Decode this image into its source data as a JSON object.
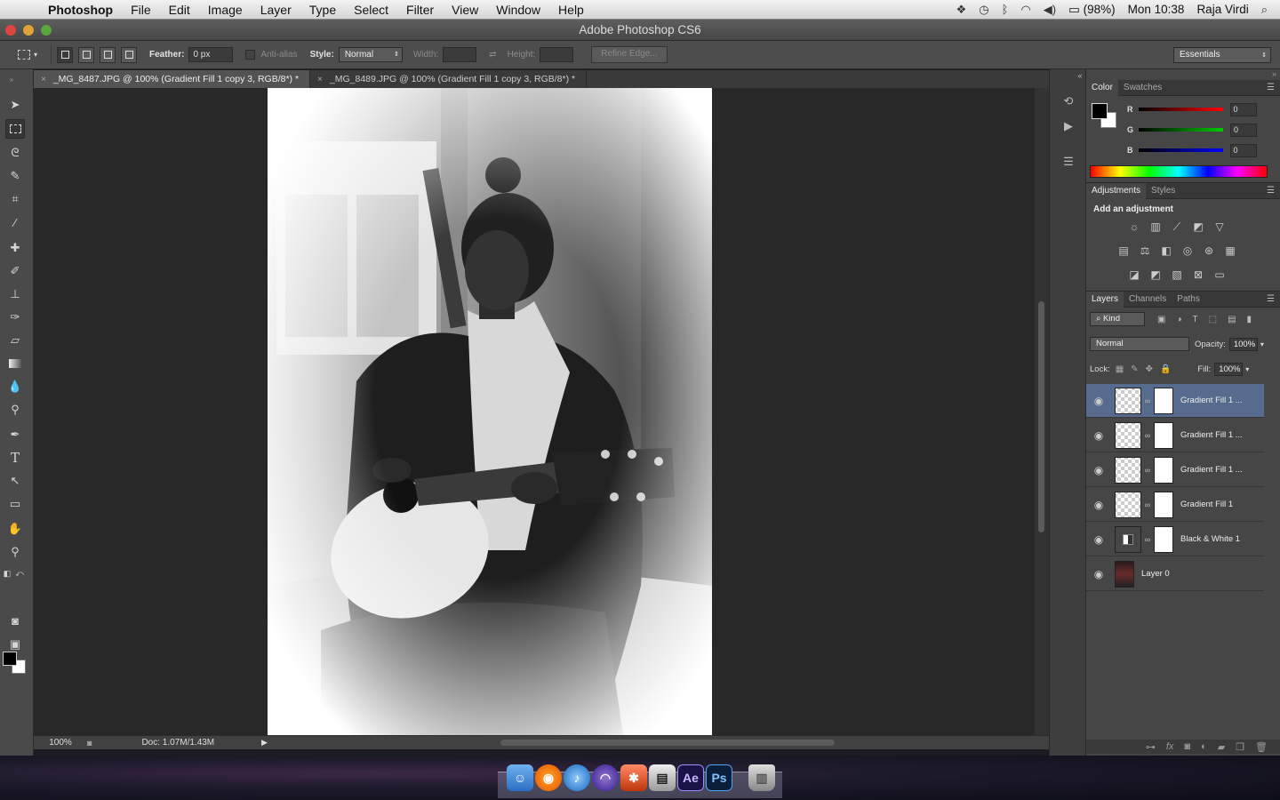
{
  "menubar": {
    "app": "Photoshop",
    "menus": [
      "File",
      "Edit",
      "Image",
      "Layer",
      "Type",
      "Select",
      "Filter",
      "View",
      "Window",
      "Help"
    ],
    "battery": "(98%)",
    "clock": "Mon 10:38",
    "user": "Raja Virdi"
  },
  "window": {
    "title": "Adobe Photoshop CS6"
  },
  "options": {
    "feather_label": "Feather:",
    "feather_value": "0 px",
    "antialias_label": "Anti-alias",
    "style_label": "Style:",
    "style_value": "Normal",
    "width_label": "Width:",
    "height_label": "Height:",
    "refine_edge": "Refine Edge...",
    "workspace": "Essentials"
  },
  "tabs": [
    {
      "label": "_MG_8487.JPG @ 100% (Gradient Fill 1 copy 3, RGB/8*) *",
      "active": true
    },
    {
      "label": "_MG_8489.JPG @ 100% (Gradient Fill 1 copy 3, RGB/8*) *",
      "active": false
    }
  ],
  "status": {
    "zoom": "100%",
    "doc": "Doc: 1.07M/1.43M"
  },
  "color_panel": {
    "tabs": [
      "Color",
      "Swatches"
    ],
    "r_label": "R",
    "g_label": "G",
    "b_label": "B",
    "r": "0",
    "g": "0",
    "b": "0"
  },
  "adjustments_panel": {
    "tabs": [
      "Adjustments",
      "Styles"
    ],
    "title": "Add an adjustment"
  },
  "layers_panel": {
    "tabs": [
      "Layers",
      "Channels",
      "Paths"
    ],
    "kind": "Kind",
    "blend_mode": "Normal",
    "opacity_label": "Opacity:",
    "opacity": "100%",
    "lock_label": "Lock:",
    "fill_label": "Fill:",
    "fill": "100%",
    "layers": [
      {
        "name": "Gradient Fill 1 ...",
        "selected": true
      },
      {
        "name": "Gradient Fill 1 ...",
        "selected": false
      },
      {
        "name": "Gradient Fill 1 ...",
        "selected": false
      },
      {
        "name": "Gradient Fill 1",
        "selected": false
      },
      {
        "name": "Black & White 1",
        "selected": false
      },
      {
        "name": "Layer 0",
        "selected": false
      }
    ]
  },
  "dock": {
    "ae_label": "Ae",
    "ps_label": "Ps"
  },
  "colors": {
    "selected_layer": "#566b8d",
    "panel_bg": "#464646",
    "canvas_bg": "#282828"
  }
}
